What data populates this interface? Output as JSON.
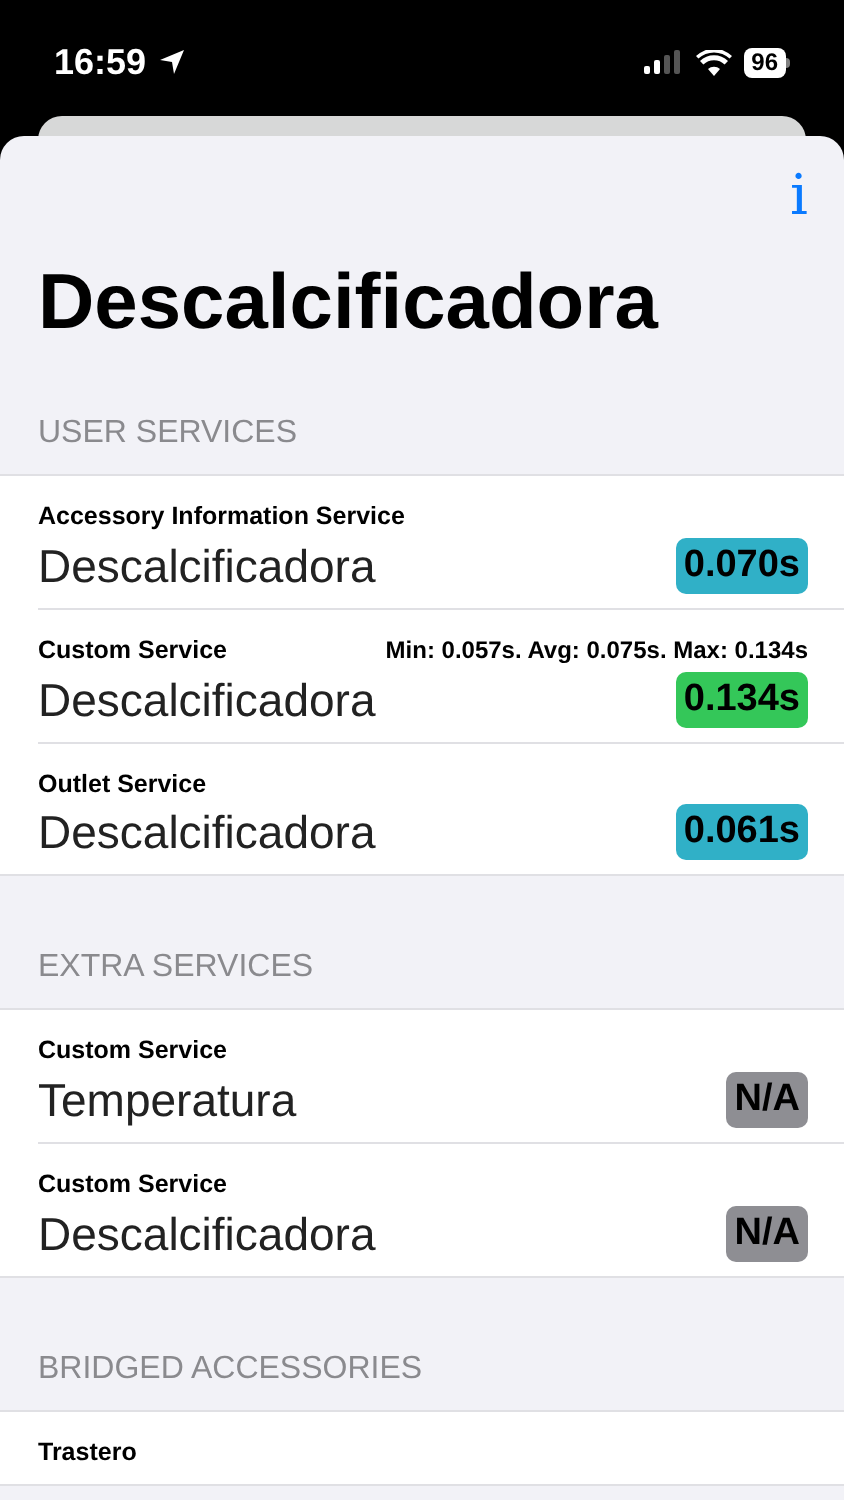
{
  "status_bar": {
    "time": "16:59",
    "battery": "96"
  },
  "info_button": {
    "label": "i"
  },
  "title": "Descalcificadora",
  "sections": [
    {
      "header": "USER SERVICES",
      "rows": [
        {
          "service": "Accessory Information Service",
          "name": "Descalcificadora",
          "badge": "0.070s",
          "color": "#30b0c7"
        },
        {
          "service": "Custom Service",
          "stats": "Min: 0.057s. Avg: 0.075s. Max: 0.134s",
          "name": "Descalcificadora",
          "badge": "0.134s",
          "color": "#34c759"
        },
        {
          "service": "Outlet Service",
          "name": "Descalcificadora",
          "badge": "0.061s",
          "color": "#30b0c7"
        }
      ]
    },
    {
      "header": "EXTRA SERVICES",
      "rows": [
        {
          "service": "Custom Service",
          "name": "Temperatura",
          "badge": "N/A",
          "color": "#8e8e93"
        },
        {
          "service": "Custom Service",
          "name": "Descalcificadora",
          "badge": "N/A",
          "color": "#8e8e93"
        }
      ]
    },
    {
      "header": "BRIDGED ACCESSORIES",
      "rows": [
        {
          "service": "Trastero"
        }
      ]
    }
  ]
}
